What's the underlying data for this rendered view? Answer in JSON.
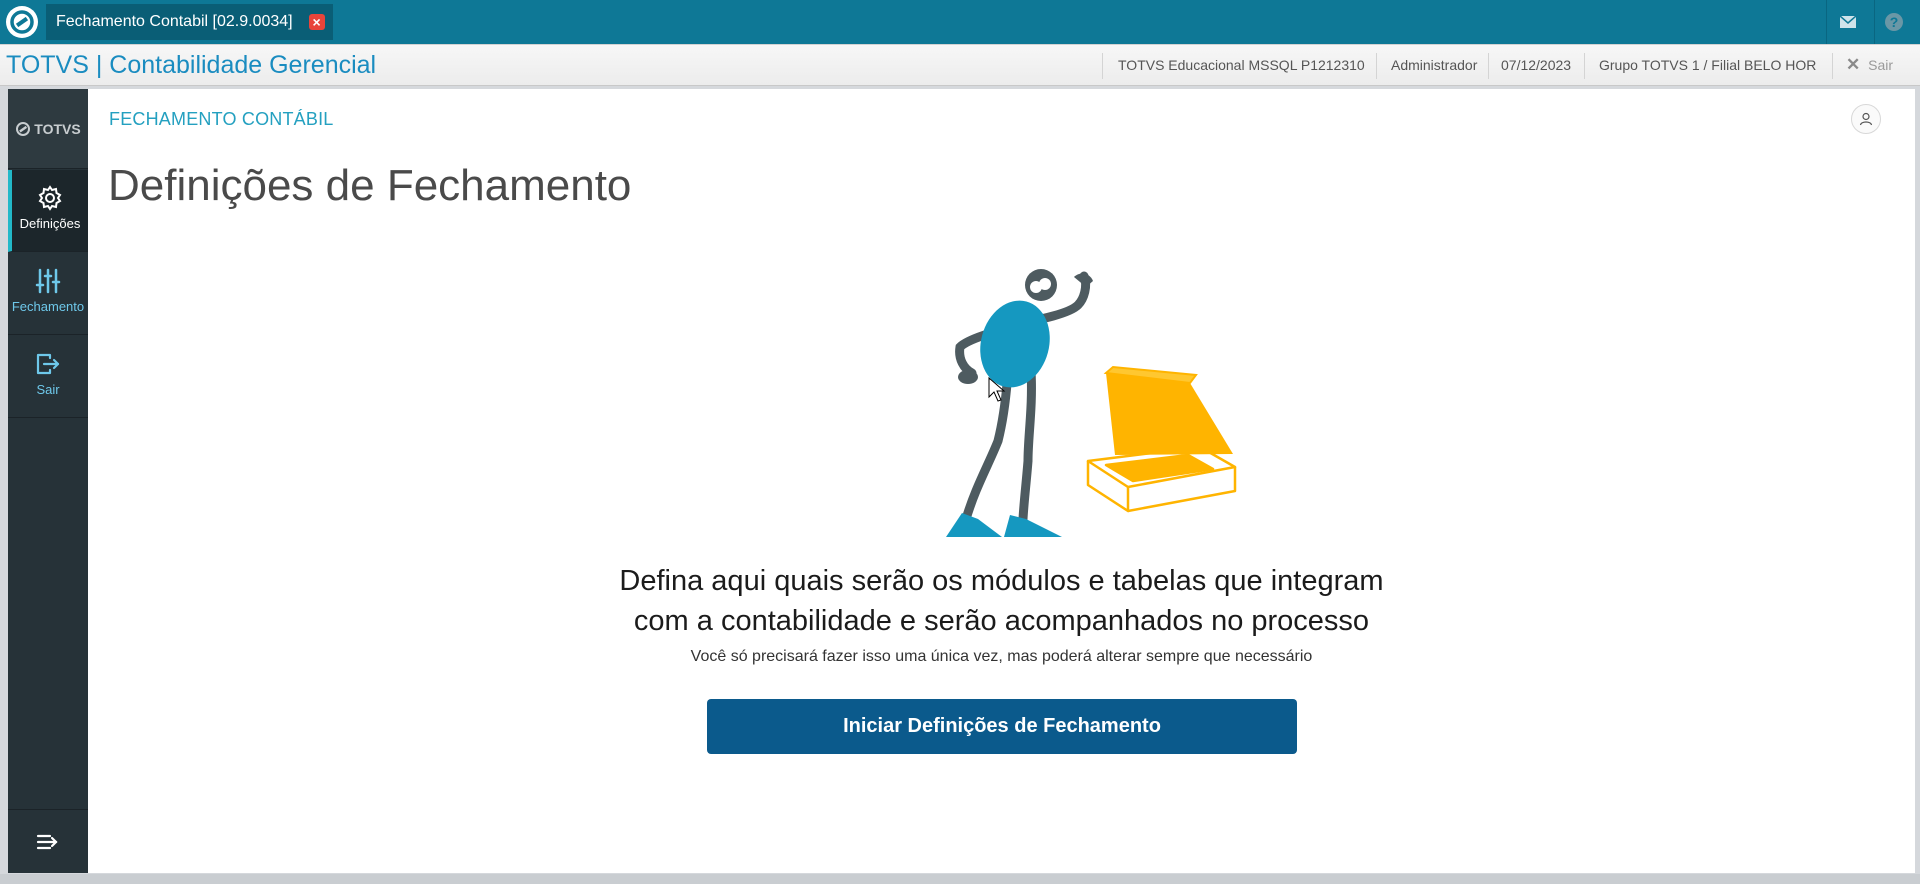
{
  "topbar": {
    "tab_label": "Fechamento Contabil [02.9.0034]",
    "icons": [
      "totvs-logo-icon",
      "close-tab-icon",
      "mail-icon",
      "help-icon"
    ]
  },
  "header": {
    "app_title": "TOTVS | Contabilidade Gerencial",
    "environment": "TOTVS Educacional MSSQL P1212310",
    "user": "Administrador",
    "date": "07/12/2023",
    "branch": "Grupo TOTVS 1 / Filial BELO HOR",
    "logout_label": "Sair"
  },
  "sidebar": {
    "logo_text": "TOTVS",
    "items": [
      {
        "label": "Definições",
        "icon": "gear-icon",
        "active": true
      },
      {
        "label": "Fechamento",
        "icon": "sliders-icon",
        "active": false
      },
      {
        "label": "Sair",
        "icon": "exit-icon",
        "active": false
      }
    ]
  },
  "main": {
    "breadcrumb": "FECHAMENTO CONTÁBIL",
    "page_title": "Definições de Fechamento",
    "headline_line1": "Defina aqui quais serão os módulos e tabelas que integram",
    "headline_line2": "com a contabilidade e serão acompanhados no processo",
    "subline": "Você só precisará fazer isso uma única vez, mas poderá alterar sempre que necessário",
    "cta_label": "Iniciar Definições de Fechamento"
  },
  "colors": {
    "topbar": "#0e7896",
    "sidebar": "#263238",
    "accent": "#24a0c0",
    "button": "#0b5a8c",
    "box": "#ffb400",
    "figure_body": "#1598c0",
    "figure_limbs": "#4e5b60"
  }
}
